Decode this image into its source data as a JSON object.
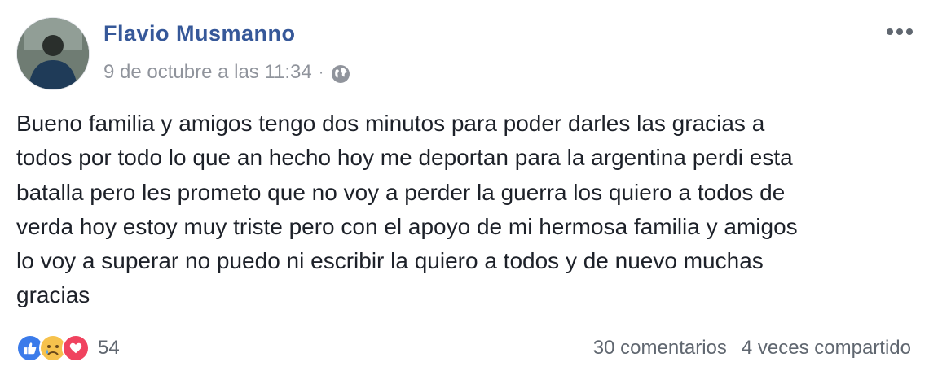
{
  "post": {
    "author": "Flavio Musmanno",
    "timestamp": "9 de octubre a las 11:34",
    "separator": "·",
    "privacy_icon": "globe-icon",
    "more_icon": "more-options-icon",
    "text_lines": [
      "Bueno familia y amigos tengo dos minutos para poder darles las gracias a",
      "todos por todo lo que an hecho hoy me deportan para la argentina perdi esta",
      "batalla pero les prometo que no voy a perder la guerra los quiero a todos de",
      "verda hoy estoy muy triste pero con el apoyo de mi hermosa familia y amigos",
      "lo voy a superar no puedo ni escribir la quiero a todos y de nuevo muchas",
      "gracias"
    ]
  },
  "footer": {
    "reactions": [
      "like-icon",
      "sad-icon",
      "love-icon"
    ],
    "reaction_count": "54",
    "comments": "30 comentarios",
    "shares": "4 veces compartido"
  },
  "colors": {
    "author_link": "#365899",
    "meta_text": "#90949c",
    "like": "#3b7bea",
    "sad": "#f6c24d",
    "love": "#f0435f"
  }
}
